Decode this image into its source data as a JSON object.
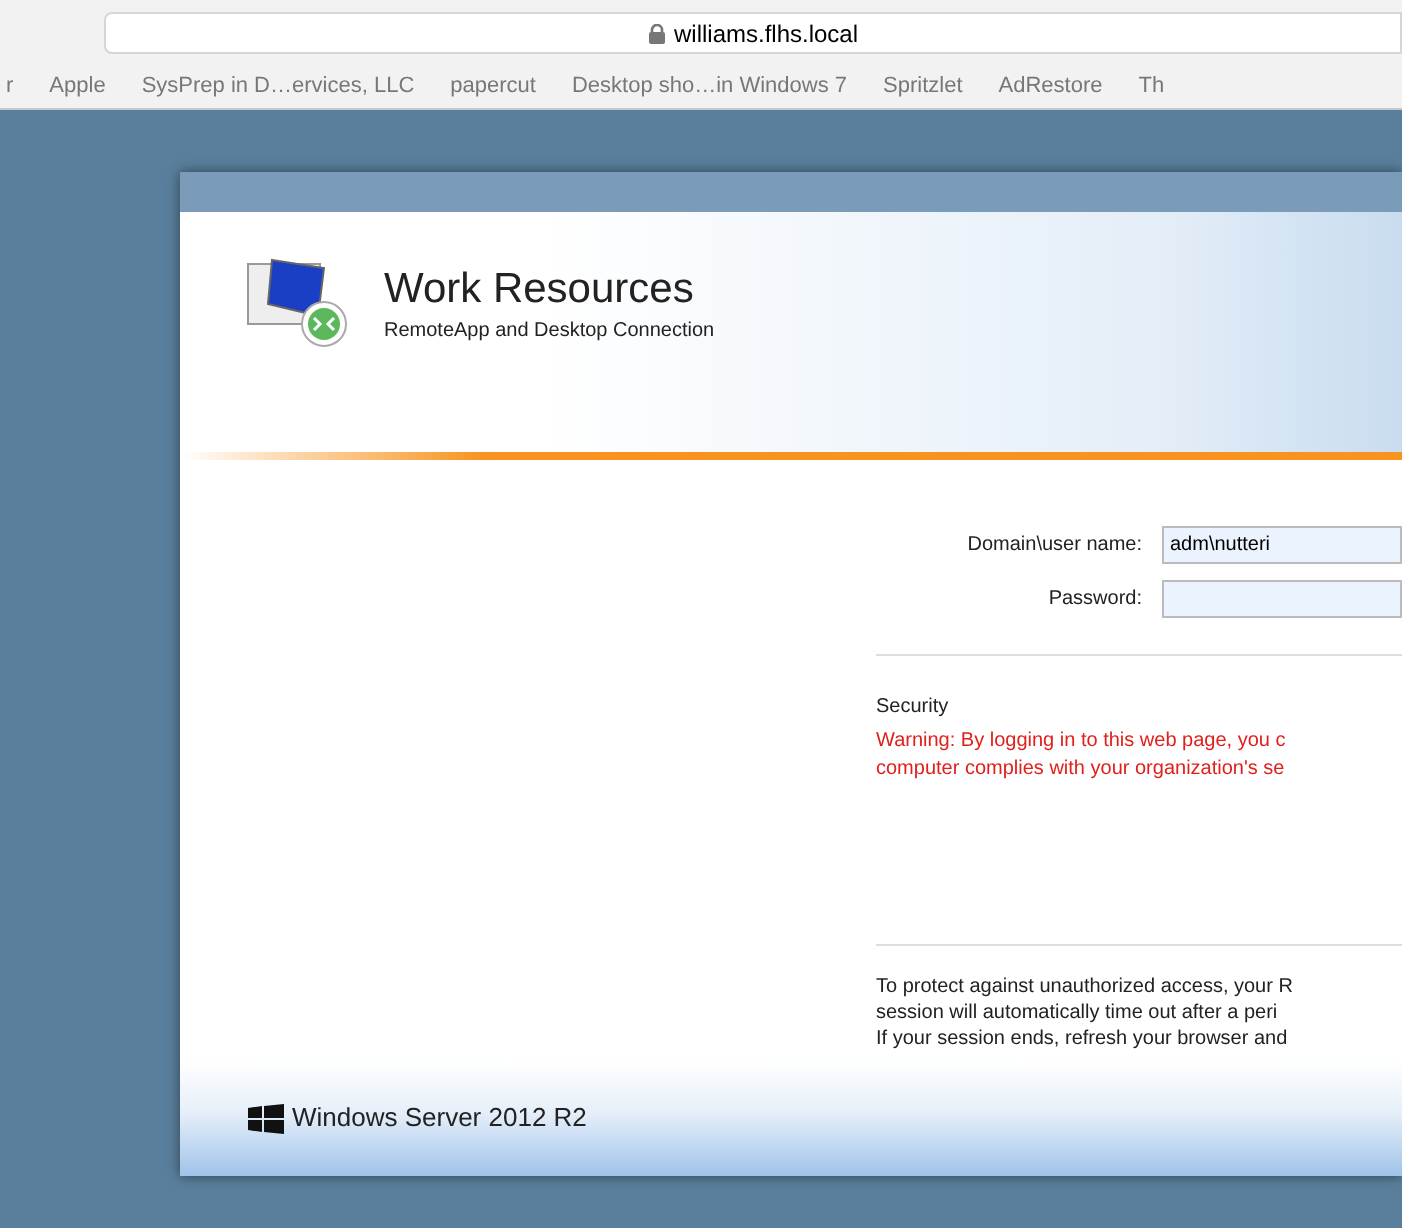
{
  "browser": {
    "address": "williams.flhs.local",
    "bookmarks": [
      "r",
      "Apple",
      "SysPrep in D…ervices, LLC",
      "papercut",
      "Desktop sho…in Windows 7",
      "Spritzlet",
      "AdRestore",
      "Th"
    ]
  },
  "header": {
    "title": "Work Resources",
    "subtitle": "RemoteApp and Desktop Connection"
  },
  "form": {
    "fields": [
      {
        "label": "Domain\\user name:",
        "value": "adm\\nutteri"
      },
      {
        "label": "Password:"
      }
    ]
  },
  "security": {
    "heading": "Security",
    "warning": [
      "Warning: By logging in to this web page, you c",
      "computer complies with your organization's se"
    ]
  },
  "notice": [
    "To protect against unauthorized access, your R",
    "session will automatically time out after a peri",
    "If your session ends, refresh your browser and"
  ],
  "footer": {
    "product": "Windows Server 2012 R2"
  }
}
